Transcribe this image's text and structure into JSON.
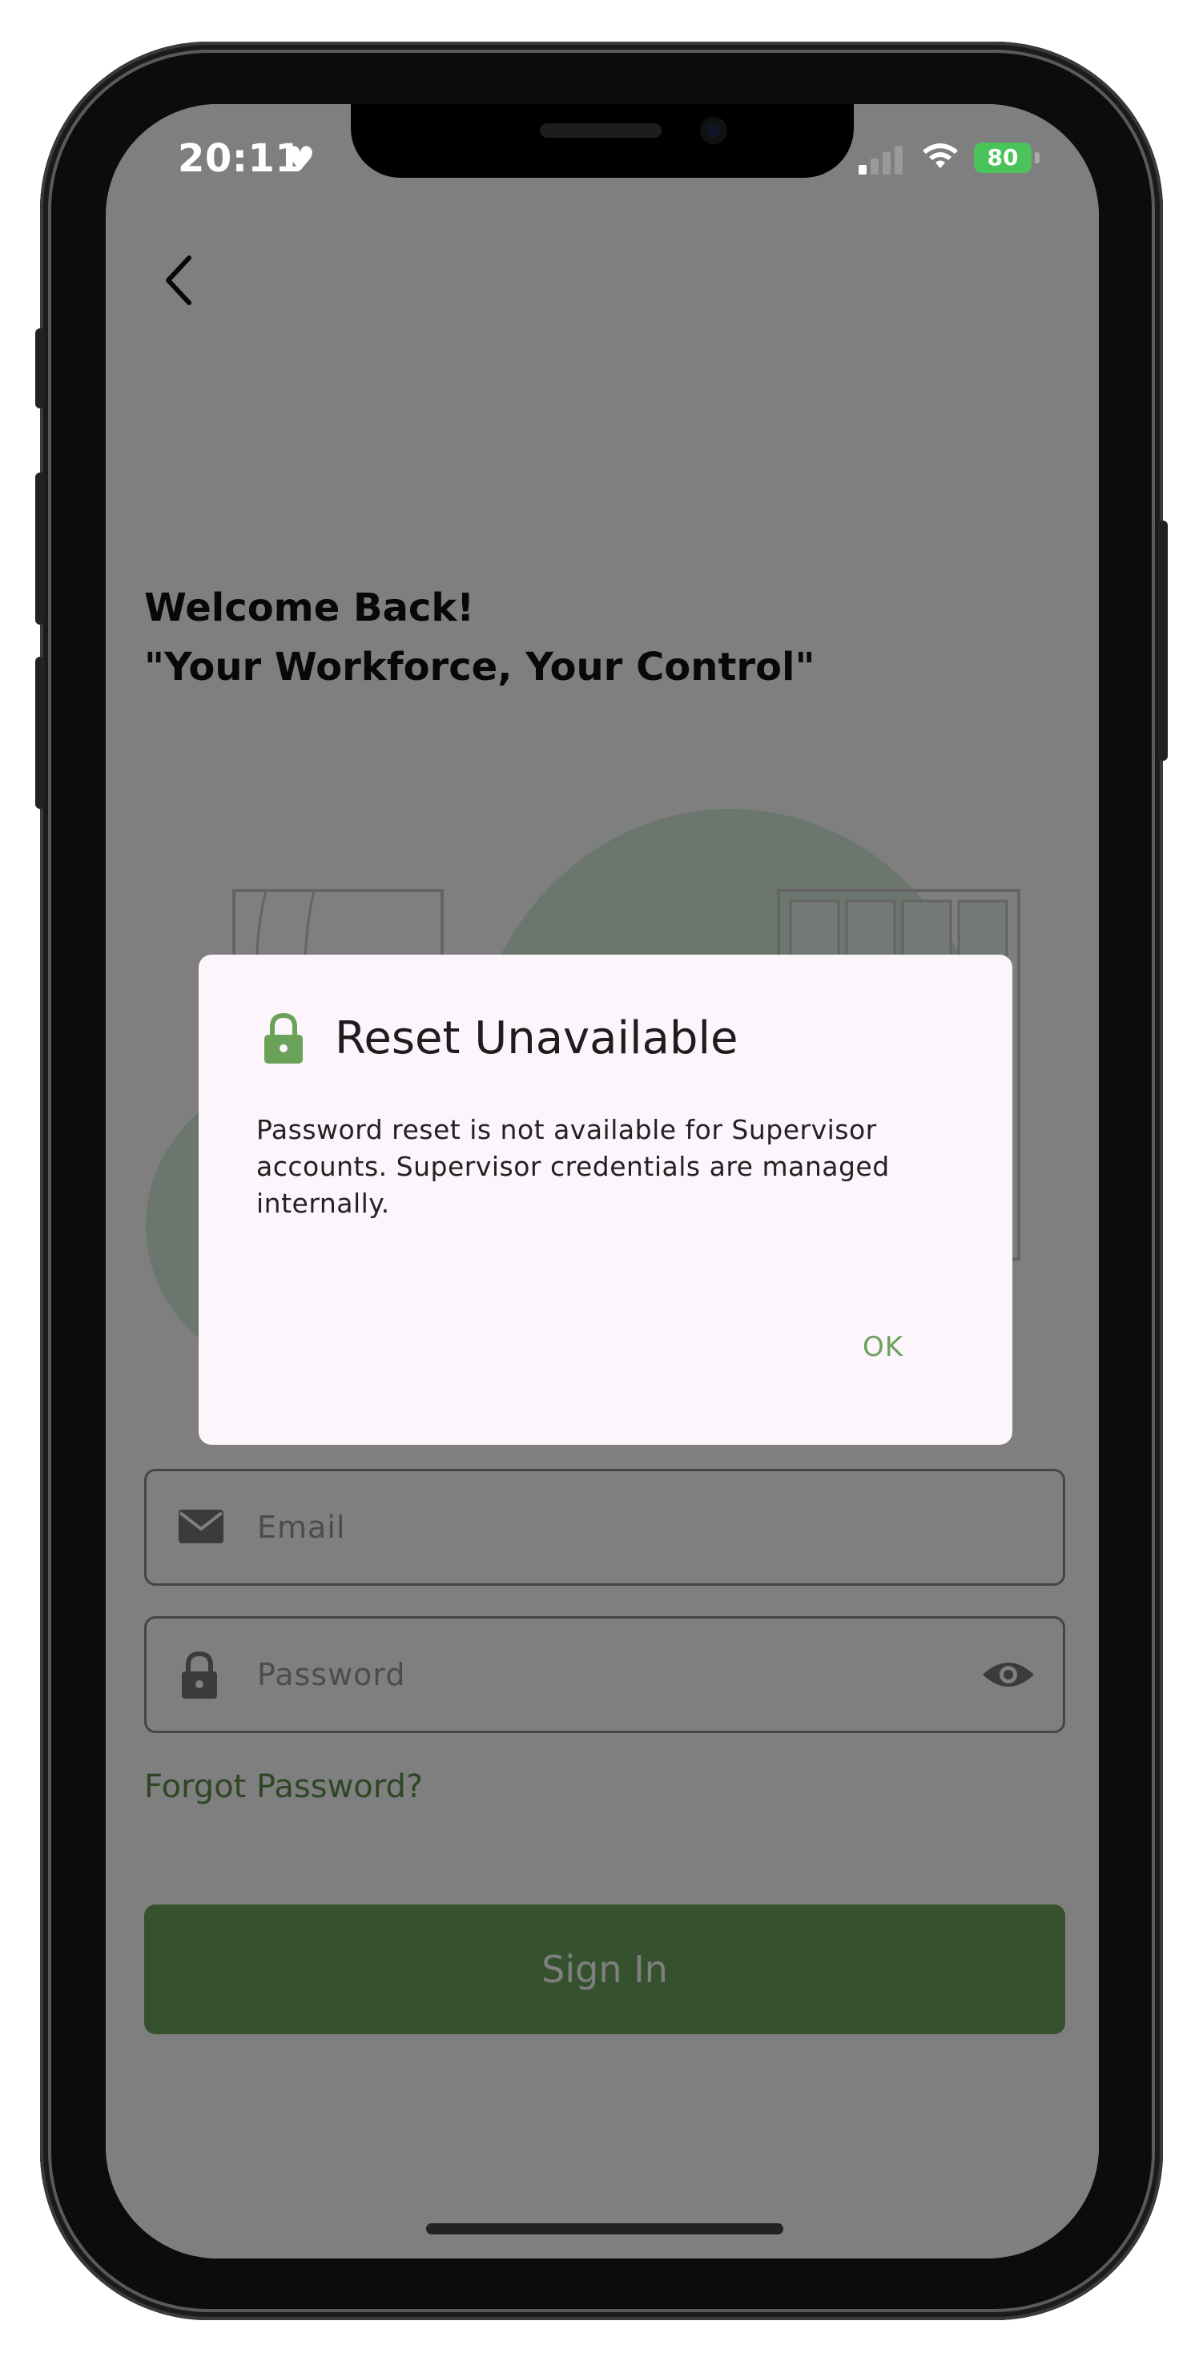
{
  "status_bar": {
    "time": "20:11",
    "battery": "80"
  },
  "login": {
    "welcome_line1": "Welcome Back!",
    "welcome_line2": "\"Your Workforce, Your Control\"",
    "email_placeholder": "Email",
    "password_placeholder": "Password",
    "forgot_password": "Forgot Password?",
    "sign_in": "Sign In"
  },
  "dialog": {
    "title": "Reset Unavailable",
    "message": "Password reset is not available for Supervisor accounts. Supervisor credentials are managed internally.",
    "ok_label": "OK"
  },
  "colors": {
    "accent": "#6da35a",
    "dialog_bg": "#fcf5fc",
    "overlay": "rgba(0,0,0,0.5)"
  },
  "icons": [
    "heart-icon",
    "back-arrow-icon",
    "lock-icon",
    "mail-icon",
    "eye-icon",
    "wifi-icon",
    "signal-icon",
    "battery-icon"
  ]
}
